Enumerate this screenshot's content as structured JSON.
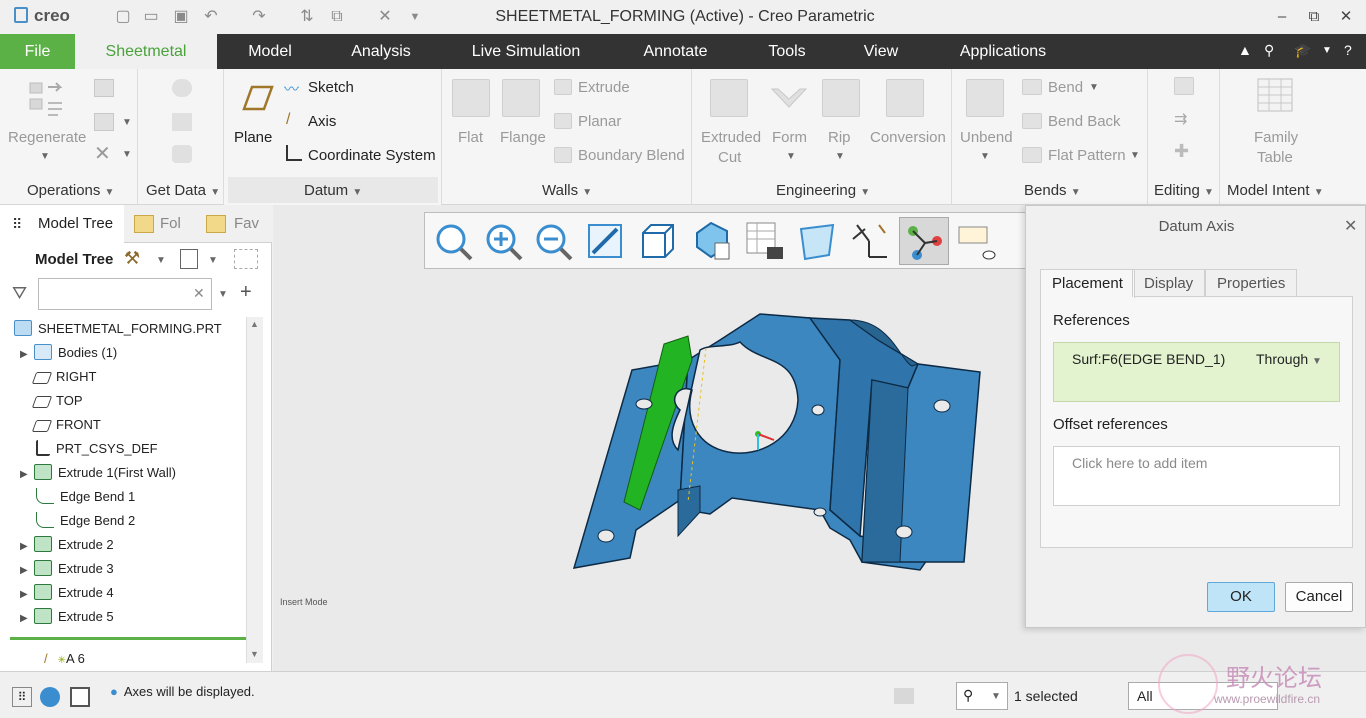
{
  "app": {
    "logo": "creo",
    "window_title": "SHEETMETAL_FORMING (Active) - Creo Parametric"
  },
  "menu": {
    "tabs": [
      "File",
      "Sheetmetal",
      "Model",
      "Analysis",
      "Live Simulation",
      "Annotate",
      "Tools",
      "View",
      "Applications"
    ]
  },
  "ribbon": {
    "operations": {
      "label": "Operations",
      "regenerate": "Regenerate"
    },
    "get_data": {
      "label": "Get Data"
    },
    "datum": {
      "label": "Datum",
      "plane": "Plane",
      "sketch": "Sketch",
      "axis": "Axis",
      "csys": "Coordinate System"
    },
    "walls": {
      "label": "Walls",
      "flat": "Flat",
      "flange": "Flange",
      "extrude": "Extrude",
      "planar": "Planar",
      "boundary_blend": "Boundary Blend"
    },
    "engineering": {
      "label": "Engineering",
      "extruded_cut_1": "Extruded",
      "extruded_cut_2": "Cut",
      "form": "Form",
      "rip": "Rip",
      "conversion": "Conversion"
    },
    "bends": {
      "label": "Bends",
      "unbend": "Unbend",
      "bend": "Bend",
      "bend_back": "Bend Back",
      "flat_pattern": "Flat Pattern"
    },
    "editing": {
      "label": "Editing"
    },
    "model_intent": {
      "label": "Model Intent",
      "family_table_1": "Family",
      "family_table_2": "Table"
    }
  },
  "left_panel": {
    "tabs": [
      "Model Tree",
      "Fol",
      "Fav"
    ],
    "header": "Model Tree",
    "tree": [
      {
        "label": "SHEETMETAL_FORMING.PRT",
        "icon": "part-icon",
        "expandable": false
      },
      {
        "label": "Bodies (1)",
        "icon": "bodies-icon",
        "expandable": true
      },
      {
        "label": "RIGHT",
        "icon": "datum-plane-icon",
        "expandable": false
      },
      {
        "label": "TOP",
        "icon": "datum-plane-icon",
        "expandable": false
      },
      {
        "label": "FRONT",
        "icon": "datum-plane-icon",
        "expandable": false
      },
      {
        "label": "PRT_CSYS_DEF",
        "icon": "csys-icon",
        "expandable": false
      },
      {
        "label": "Extrude 1(First Wall)",
        "icon": "extrude-wall-icon",
        "expandable": true
      },
      {
        "label": "Edge Bend 1",
        "icon": "edge-bend-icon",
        "expandable": false
      },
      {
        "label": "Edge Bend 2",
        "icon": "edge-bend-icon",
        "expandable": false
      },
      {
        "label": "Extrude 2",
        "icon": "extrude-cut-icon",
        "expandable": true
      },
      {
        "label": "Extrude 3",
        "icon": "extrude-cut-icon",
        "expandable": true
      },
      {
        "label": "Extrude 4",
        "icon": "extrude-cut-icon",
        "expandable": true
      },
      {
        "label": "Extrude 5",
        "icon": "extrude-cut-icon",
        "expandable": true
      }
    ],
    "insert_item": "A 6"
  },
  "graphics": {
    "insert_mode": "Insert Mode"
  },
  "dialog": {
    "title": "Datum Axis",
    "tabs": [
      "Placement",
      "Display",
      "Properties"
    ],
    "references_label": "References",
    "reference_value": "Surf:F6(EDGE BEND_1)",
    "reference_constraint": "Through",
    "offset_label": "Offset references",
    "offset_placeholder": "Click here to add item",
    "ok": "OK",
    "cancel": "Cancel"
  },
  "status": {
    "message": "Axes will be displayed.",
    "selected": "1 selected",
    "filter": "All"
  },
  "watermark": {
    "text": "野火论坛",
    "url": "www.proewildfire.cn"
  },
  "colors": {
    "file_tab": "#5bb146",
    "accent_green": "#4aa23b",
    "part_blue": "#3d87c0",
    "selection_green": "#22b422",
    "reference_bg": "#e3f2cf",
    "ok_button": "#bfe3f7"
  }
}
